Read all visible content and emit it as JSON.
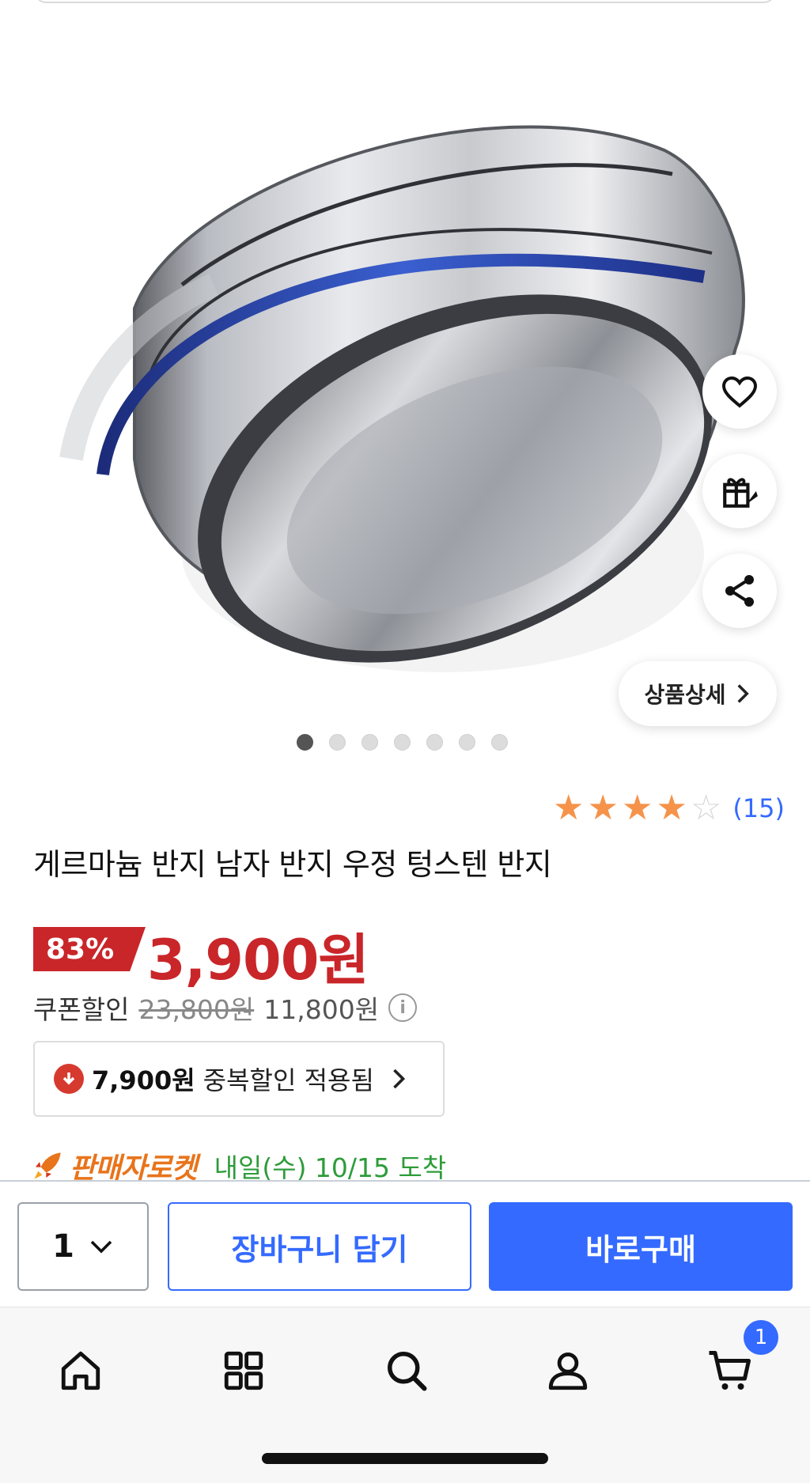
{
  "product": {
    "title": "게르마늄 반지 남자 반지 우정 텅스텐 반지",
    "rating": {
      "stars": 4,
      "max": 5,
      "count_label": "(15)"
    },
    "image_dots": {
      "count": 7,
      "active_index": 0
    },
    "detail_button_label": "상품상세",
    "discount_label": "83%",
    "price": "3,900원",
    "coupon": {
      "label": "쿠폰할인",
      "original_price": "23,800원",
      "coupon_price": "11,800원"
    },
    "dup_discount": {
      "amount": "7,900원",
      "text": "중복할인 적용됨"
    },
    "delivery": {
      "rocket_label": "판매자로켓",
      "text": "내일(수) 10/15 도착"
    }
  },
  "purchase_bar": {
    "quantity": "1",
    "cart_label": "장바구니 담기",
    "buy_label": "바로구매"
  },
  "tabbar": {
    "items": [
      "home-icon",
      "category-icon",
      "search-icon",
      "my-page-icon",
      "cart-icon"
    ],
    "cart_badge": "1"
  },
  "colors": {
    "accent": "#346aff",
    "discount_red": "#c9262a",
    "star": "#f5934a",
    "delivery_green": "#2e9c3a",
    "rocket_orange": "#e8741b"
  }
}
